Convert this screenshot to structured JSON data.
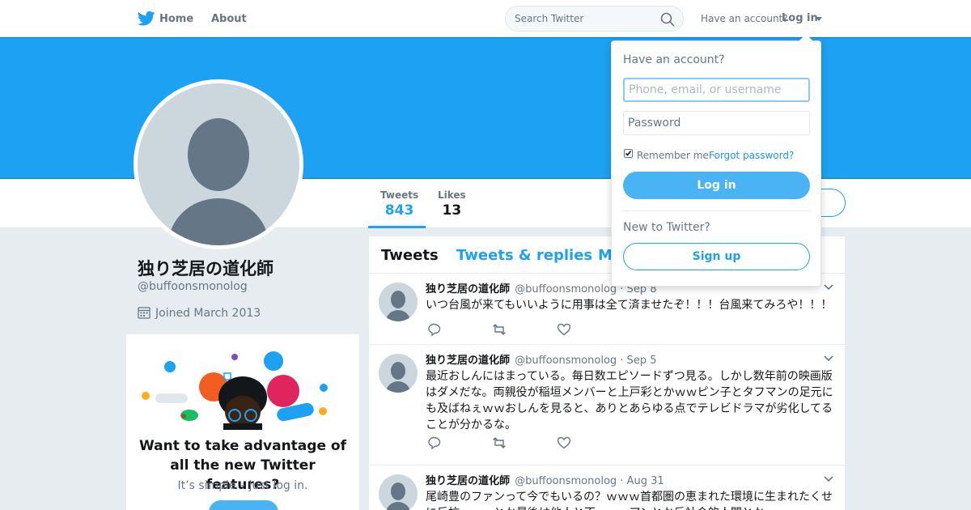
{
  "nav": {
    "home_label": "Home",
    "about_label": "About",
    "search_placeholder": "Search Twitter",
    "have_account": "Have an account?",
    "login_label": "Log in"
  },
  "colors": {
    "brand": "#1da1f2",
    "link": "#1b95e0",
    "button": "#4ab3f4"
  },
  "profile": {
    "display_name": "独り芝居の道化師",
    "screen_name": "@buffoonsmonolog",
    "joined": "Joined March 2013",
    "stats": [
      {
        "label": "Tweets",
        "value": "843"
      },
      {
        "label": "Likes",
        "value": "13"
      }
    ]
  },
  "promo": {
    "title": "Want to take advantage of all the new Twitter features?",
    "subtitle": "It’s simple – just log in."
  },
  "timeline": {
    "tabs": [
      "Tweets",
      "Tweets & replies",
      "M"
    ],
    "tweets": [
      {
        "name": "独り芝居の道化師",
        "handle": "@buffoonsmonolog",
        "date": "· Sep 8",
        "text": "いつ台風が来てもいいように用事は全て済ませたぞ！！！台風来てみろや！！！"
      },
      {
        "name": "独り芝居の道化師",
        "handle": "@buffoonsmonolog",
        "date": "· Sep 5",
        "text": "最近おしんにはまっている。毎日数エピソードずつ見る。しかし数年前の映画版はダメだな。両親役が稲垣メンバーと上戸彩とかｗｗピン子とタフマンの足元にも及ばねぇｗｗおしんを見ると、ありとあらゆる点でテレビドラマが劣化してることが分かるな。"
      },
      {
        "name": "独り芝居の道化師",
        "handle": "@buffoonsmonolog",
        "date": "· Aug 31",
        "text": "尾崎豊のファンって今でもいるの？ｗｗｗ首都圏の恵まれた環境に生まれたくせに反抗ーーｗとか最後は他人と不ーーーアンとか反社会的人間とか"
      }
    ]
  },
  "login_dropdown": {
    "title": "Have an account?",
    "username_placeholder": "Phone, email, or username",
    "password_placeholder": "Password",
    "remember": "Remember me ·",
    "forgot": "Forgot password?",
    "login_button": "Log in",
    "new_label": "New to Twitter?",
    "signup_button": "Sign up"
  }
}
